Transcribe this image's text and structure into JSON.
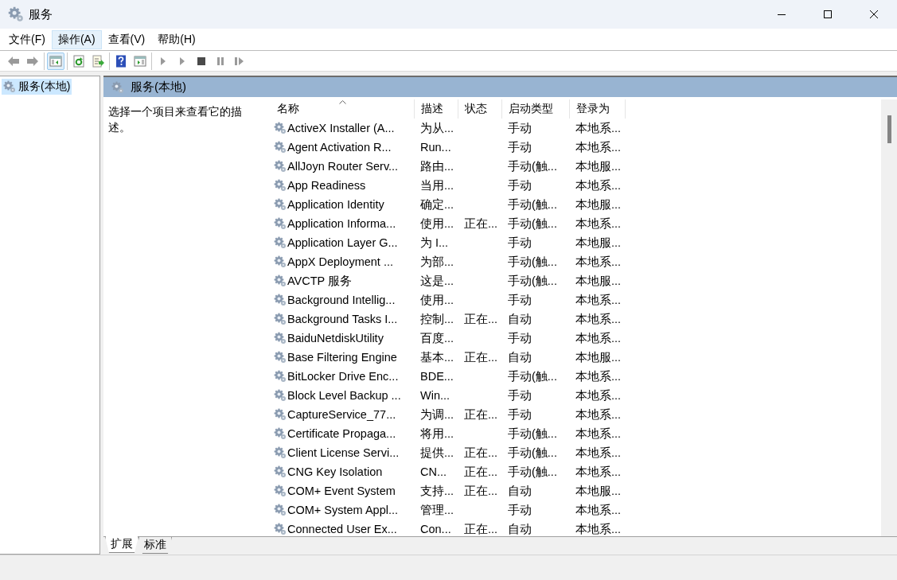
{
  "window": {
    "title": "服务"
  },
  "menu": [
    {
      "label": "文件(F)",
      "selected": false
    },
    {
      "label": "操作(A)",
      "selected": true
    },
    {
      "label": "查看(V)",
      "selected": false
    },
    {
      "label": "帮助(H)",
      "selected": false
    }
  ],
  "toolbar": [
    [
      {
        "kind": "back",
        "pressed": false
      },
      {
        "kind": "forward",
        "pressed": false
      }
    ],
    [
      {
        "kind": "tree",
        "pressed": true
      }
    ],
    [
      {
        "kind": "refresh",
        "pressed": false
      },
      {
        "kind": "export",
        "pressed": false
      }
    ],
    [
      {
        "kind": "help",
        "pressed": false
      },
      {
        "kind": "pane",
        "pressed": false
      }
    ],
    [
      {
        "kind": "start",
        "pressed": false
      },
      {
        "kind": "start",
        "pressed": false
      },
      {
        "kind": "stop",
        "pressed": false
      },
      {
        "kind": "pause",
        "pressed": false
      },
      {
        "kind": "resume",
        "pressed": false
      }
    ]
  ],
  "tree": {
    "items": [
      {
        "label": "服务(本地)",
        "selected": true
      }
    ]
  },
  "panel": {
    "title": "服务(本地)",
    "description": "选择一个项目来查看它的描述。"
  },
  "table": {
    "columns": [
      {
        "label": "名称",
        "sorted": true
      },
      {
        "label": "描述",
        "sorted": false
      },
      {
        "label": "状态",
        "sorted": false
      },
      {
        "label": "启动类型",
        "sorted": false
      },
      {
        "label": "登录为",
        "sorted": false
      }
    ],
    "rows": [
      [
        "ActiveX Installer (A...",
        "为从...",
        "",
        "手动",
        "本地系..."
      ],
      [
        "Agent Activation R...",
        "Run...",
        "",
        "手动",
        "本地系..."
      ],
      [
        "AllJoyn Router Serv...",
        "路由...",
        "",
        "手动(触...",
        "本地服..."
      ],
      [
        "App Readiness",
        "当用...",
        "",
        "手动",
        "本地系..."
      ],
      [
        "Application Identity",
        "确定...",
        "",
        "手动(触...",
        "本地服..."
      ],
      [
        "Application Informa...",
        "使用...",
        "正在...",
        "手动(触...",
        "本地系..."
      ],
      [
        "Application Layer G...",
        "为 I...",
        "",
        "手动",
        "本地服..."
      ],
      [
        "AppX Deployment ...",
        "为部...",
        "",
        "手动(触...",
        "本地系..."
      ],
      [
        "AVCTP 服务",
        "这是...",
        "",
        "手动(触...",
        "本地服..."
      ],
      [
        "Background Intellig...",
        "使用...",
        "",
        "手动",
        "本地系..."
      ],
      [
        "Background Tasks I...",
        "控制...",
        "正在...",
        "自动",
        "本地系..."
      ],
      [
        "BaiduNetdiskUtility",
        "百度...",
        "",
        "手动",
        "本地系..."
      ],
      [
        "Base Filtering Engine",
        "基本...",
        "正在...",
        "自动",
        "本地服..."
      ],
      [
        "BitLocker Drive Enc...",
        "BDE...",
        "",
        "手动(触...",
        "本地系..."
      ],
      [
        "Block Level Backup ...",
        "Win...",
        "",
        "手动",
        "本地系..."
      ],
      [
        "CaptureService_77...",
        "为调...",
        "正在...",
        "手动",
        "本地系..."
      ],
      [
        "Certificate Propaga...",
        "将用...",
        "",
        "手动(触...",
        "本地系..."
      ],
      [
        "Client License Servi...",
        "提供...",
        "正在...",
        "手动(触...",
        "本地系..."
      ],
      [
        "CNG Key Isolation",
        "CN...",
        "正在...",
        "手动(触...",
        "本地系..."
      ],
      [
        "COM+ Event System",
        "支持...",
        "正在...",
        "自动",
        "本地服..."
      ],
      [
        "COM+ System Appl...",
        "管理...",
        "",
        "手动",
        "本地系..."
      ],
      [
        "Connected User Ex...",
        "Con...",
        "正在...",
        "自动",
        "本地系..."
      ]
    ]
  },
  "view_tabs": [
    {
      "label": "扩展",
      "selected": true
    },
    {
      "label": "标准",
      "selected": false
    }
  ]
}
